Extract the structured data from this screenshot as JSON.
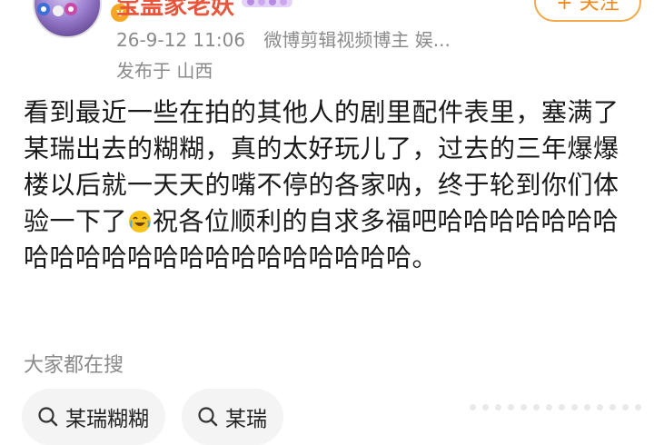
{
  "header": {
    "username": "宝盖家老妖",
    "vip_badge": "v",
    "follow_label": "+ 关注",
    "post_time": "26-9-12 11:06",
    "source": "微博剪辑视频博主 娱...",
    "location": "发布于 山西"
  },
  "post": {
    "text_before_emoji": "看到最近一些在拍的其他人的剧里配件表里，塞满了某瑞出去的糊糊，真的太好玩儿了，过去的三年爆爆楼以后就一天天的嘴不停的各家呐，终于轮到你们体验一下了",
    "emoji": "laugh-crying-icon",
    "text_after_emoji": "祝各位顺利的自求多福吧哈哈哈哈哈哈哈哈哈哈哈哈哈哈哈哈哈哈哈哈哈哈。"
  },
  "search": {
    "title": "大家都在搜",
    "chips": [
      {
        "label": "某瑞糊糊"
      },
      {
        "label": "某瑞"
      }
    ]
  },
  "colors": {
    "username": "#e8553a",
    "follow": "#f08a1c",
    "meta": "#8a8a8a"
  }
}
